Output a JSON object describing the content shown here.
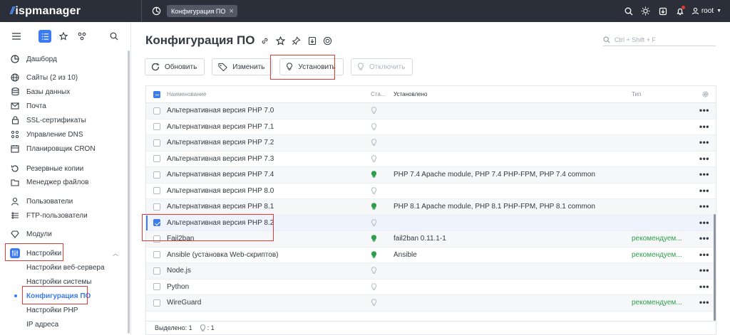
{
  "topbar": {
    "logo_mark": "//",
    "logo_text": "ispmanager",
    "tab_label": "Конфигурация ПО",
    "user": "root"
  },
  "sidebar": {
    "items": [
      {
        "label": "Дашборд",
        "icon": "pie-chart-icon"
      },
      {
        "label": "Сайты (2 из 10)",
        "icon": "globe-icon"
      },
      {
        "label": "Базы данных",
        "icon": "database-icon"
      },
      {
        "label": "Почта",
        "icon": "mail-icon"
      },
      {
        "label": "SSL-сертификаты",
        "icon": "lock-icon"
      },
      {
        "label": "Управление DNS",
        "icon": "dns-icon"
      },
      {
        "label": "Планировщик CRON",
        "icon": "calendar-icon"
      },
      {
        "label": "Резервные копии",
        "icon": "backup-icon"
      },
      {
        "label": "Менеджер файлов",
        "icon": "folder-icon"
      },
      {
        "label": "Пользователи",
        "icon": "user-icon"
      },
      {
        "label": "FTP-пользователи",
        "icon": "ftp-icon"
      },
      {
        "label": "Модули",
        "icon": "modules-icon"
      },
      {
        "label": "Настройки",
        "icon": "settings-icon"
      }
    ],
    "subitems": [
      {
        "label": "Настройки веб-сервера"
      },
      {
        "label": "Настройки системы"
      },
      {
        "label": "Конфигурация ПО"
      },
      {
        "label": "Настройки PHP"
      },
      {
        "label": "IP адреса"
      }
    ]
  },
  "main": {
    "title": "Конфигурация ПО",
    "search_placeholder": "Ctrl + Shift + F",
    "toolbar": {
      "refresh": "Обновить",
      "edit": "Изменить",
      "install": "Установить",
      "disable": "Отключить"
    },
    "columns": {
      "name": "Наименование",
      "status": "Ста...",
      "installed": "Установлено",
      "type": "Тип"
    },
    "rows": [
      {
        "name": "Альтернативная версия PHP 7.0",
        "installed": "",
        "type": "",
        "active": false
      },
      {
        "name": "Альтернативная версия PHP 7.1",
        "installed": "",
        "type": "",
        "active": false
      },
      {
        "name": "Альтернативная версия PHP 7.2",
        "installed": "",
        "type": "",
        "active": false
      },
      {
        "name": "Альтернативная версия PHP 7.3",
        "installed": "",
        "type": "",
        "active": false
      },
      {
        "name": "Альтернативная версия PHP 7.4",
        "installed": "PHP 7.4 Apache module, PHP 7.4 PHP-FPM, PHP 7.4 common",
        "type": "",
        "active": true
      },
      {
        "name": "Альтернативная версия PHP 8.0",
        "installed": "",
        "type": "",
        "active": false
      },
      {
        "name": "Альтернативная версия PHP 8.1",
        "installed": "PHP 8.1 Apache module, PHP 8.1 PHP-FPM, PHP 8.1 common",
        "type": "",
        "active": true
      },
      {
        "name": "Альтернативная версия PHP 8.2",
        "installed": "",
        "type": "",
        "active": false
      },
      {
        "name": "Fail2ban",
        "installed": "fail2ban 0.11.1-1",
        "type": "рекомендуем...",
        "active": true
      },
      {
        "name": "Ansible (установка Web-скриптов)",
        "installed": "Ansible",
        "type": "рекомендуем...",
        "active": true
      },
      {
        "name": "Node.js",
        "installed": "",
        "type": "",
        "active": false
      },
      {
        "name": "Python",
        "installed": "",
        "type": "",
        "active": false
      },
      {
        "name": "WireGuard",
        "installed": "",
        "type": "рекомендуем...",
        "active": false
      }
    ],
    "footer": {
      "selected_label": "Выделено: 1",
      "status_count": ": 1"
    }
  },
  "colors": {
    "accent": "#3d7bf0",
    "active_green": "#2e9e4c",
    "highlight_red": "#e53935"
  }
}
